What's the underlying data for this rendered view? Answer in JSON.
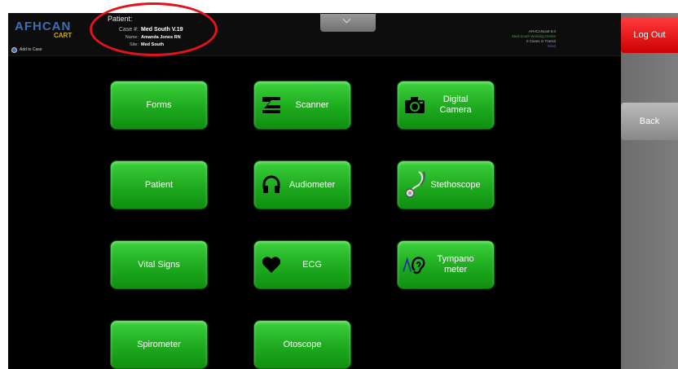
{
  "app": {
    "logo_main": "AFHCAN",
    "logo_sub": "CART",
    "add_to_case": "Add to Case"
  },
  "patient": {
    "title": "Patient:",
    "case_label": "Case #:",
    "case_value": "Med South V.19",
    "name_label": "Name:",
    "name_value": "Amanda Jones RN",
    "site_label": "Site:",
    "site_value": "Med South"
  },
  "status": {
    "line1": "AFHCANcart 8.0",
    "line2": "Med South Working Onsite",
    "line3": "0 Cases in Transit",
    "line4": "Send"
  },
  "side": {
    "logout": "Log Out",
    "back": "Back"
  },
  "buttons": {
    "forms": "Forms",
    "scanner": "Scanner",
    "digital_camera": "Digital Camera",
    "patient": "Patient",
    "audiometer": "Audiometer",
    "stethoscope": "Stethoscope",
    "vital_signs": "Vital Signs",
    "ecg": "ECG",
    "tympanometer": "Tympano meter",
    "spirometer": "Spirometer",
    "otoscope": "Otoscope"
  },
  "colors": {
    "button_green": "#1faa1f",
    "logout_red": "#e01010",
    "annotation_red": "#e3131b"
  }
}
